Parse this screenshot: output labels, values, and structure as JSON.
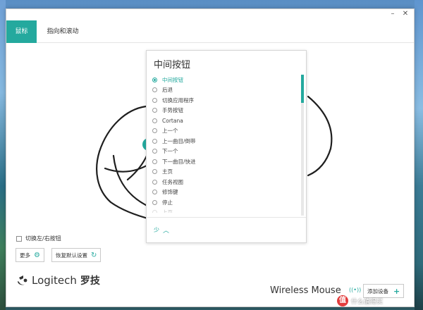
{
  "window": {
    "controls": {
      "minimize": "–",
      "close": "✕"
    }
  },
  "tabs": [
    {
      "label": "鼠标",
      "active": true
    },
    {
      "label": "指向和滚动",
      "active": false
    }
  ],
  "panel": {
    "title": "中间按钮",
    "options": [
      {
        "label": "中间按钮",
        "selected": true
      },
      {
        "label": "后退",
        "selected": false
      },
      {
        "label": "切换应用程序",
        "selected": false
      },
      {
        "label": "手势按钮",
        "selected": false
      },
      {
        "label": "Cortana",
        "selected": false
      },
      {
        "label": "上一个",
        "selected": false
      },
      {
        "label": "上一曲目/倒带",
        "selected": false
      },
      {
        "label": "下一个",
        "selected": false
      },
      {
        "label": "下一曲目/快进",
        "selected": false
      },
      {
        "label": "主页",
        "selected": false
      },
      {
        "label": "任务视图",
        "selected": false
      },
      {
        "label": "修饰键",
        "selected": false
      },
      {
        "label": "停止",
        "selected": false
      },
      {
        "label": "上页",
        "selected": false
      }
    ],
    "less_label": "少",
    "scroll_level": 0.2
  },
  "bottom": {
    "swap_buttons_label": "切换左/右按钮",
    "more_label": "更多",
    "restore_defaults_label": "恢复默认设置",
    "brand_name": "Logitech",
    "brand_cn": "罗技",
    "device_name": "Wireless Mouse",
    "add_device_label": "添加设备"
  },
  "watermark": {
    "badge": "值",
    "text": "什么值得买"
  },
  "colors": {
    "accent": "#24a99e"
  }
}
